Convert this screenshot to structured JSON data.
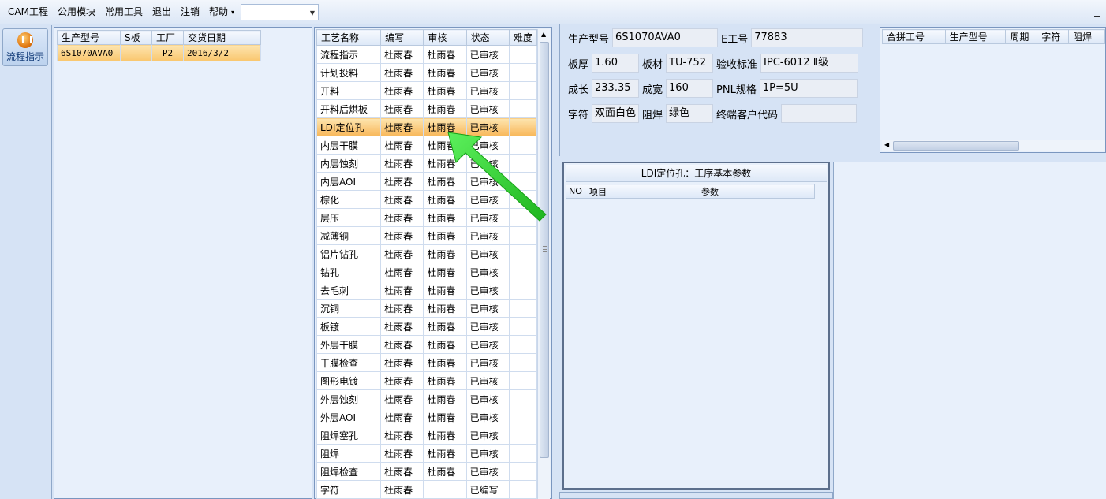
{
  "menu": {
    "items": [
      "CAM工程",
      "公用模块",
      "常用工具",
      "退出",
      "注销",
      "帮助"
    ],
    "help_arrow": "▾",
    "combo_value": "",
    "minimize": "_"
  },
  "nav": {
    "button_label": "流程指示",
    "icon": "pause-circle-icon"
  },
  "orders": {
    "headers": [
      "生产型号",
      "S板",
      "工厂",
      "交货日期"
    ],
    "rows": [
      [
        "6S1070AVA0",
        "",
        "P2",
        "2016/3/2"
      ]
    ]
  },
  "processes": {
    "headers": [
      "工艺名称",
      "编写",
      "审核",
      "状态",
      "难度"
    ],
    "selected_index": 4,
    "rows": [
      [
        "流程指示",
        "杜雨春",
        "杜雨春",
        "已审核",
        ""
      ],
      [
        "计划投料",
        "杜雨春",
        "杜雨春",
        "已审核",
        ""
      ],
      [
        "开料",
        "杜雨春",
        "杜雨春",
        "已审核",
        ""
      ],
      [
        "开料后烘板",
        "杜雨春",
        "杜雨春",
        "已审核",
        ""
      ],
      [
        "LDI定位孔",
        "杜雨春",
        "杜雨春",
        "已审核",
        ""
      ],
      [
        "内层干膜",
        "杜雨春",
        "杜雨春",
        "已审核",
        ""
      ],
      [
        "内层蚀刻",
        "杜雨春",
        "杜雨春",
        "已审核",
        ""
      ],
      [
        "内层AOI",
        "杜雨春",
        "杜雨春",
        "已审核",
        ""
      ],
      [
        "棕化",
        "杜雨春",
        "杜雨春",
        "已审核",
        ""
      ],
      [
        "层压",
        "杜雨春",
        "杜雨春",
        "已审核",
        ""
      ],
      [
        "减薄铜",
        "杜雨春",
        "杜雨春",
        "已审核",
        ""
      ],
      [
        "铝片钻孔",
        "杜雨春",
        "杜雨春",
        "已审核",
        ""
      ],
      [
        "钻孔",
        "杜雨春",
        "杜雨春",
        "已审核",
        ""
      ],
      [
        "去毛刺",
        "杜雨春",
        "杜雨春",
        "已审核",
        ""
      ],
      [
        "沉铜",
        "杜雨春",
        "杜雨春",
        "已审核",
        ""
      ],
      [
        "板镀",
        "杜雨春",
        "杜雨春",
        "已审核",
        ""
      ],
      [
        "外层干膜",
        "杜雨春",
        "杜雨春",
        "已审核",
        ""
      ],
      [
        "干膜检查",
        "杜雨春",
        "杜雨春",
        "已审核",
        ""
      ],
      [
        "图形电镀",
        "杜雨春",
        "杜雨春",
        "已审核",
        ""
      ],
      [
        "外层蚀刻",
        "杜雨春",
        "杜雨春",
        "已审核",
        ""
      ],
      [
        "外层AOI",
        "杜雨春",
        "杜雨春",
        "已审核",
        ""
      ],
      [
        "阻焊塞孔",
        "杜雨春",
        "杜雨春",
        "已审核",
        ""
      ],
      [
        "阻焊",
        "杜雨春",
        "杜雨春",
        "已审核",
        ""
      ],
      [
        "阻焊检查",
        "杜雨春",
        "杜雨春",
        "已审核",
        ""
      ],
      [
        "字符",
        "杜雨春",
        "",
        "已编写",
        ""
      ]
    ]
  },
  "info": {
    "model_label": "生产型号",
    "model_value": "6S1070AVA0",
    "eno_label": "E工号",
    "eno_value": "77883",
    "thickness_label": "板厚",
    "thickness_value": "1.60",
    "material_label": "板材",
    "material_value": "TU-752",
    "standard_label": "验收标准",
    "standard_value": "IPC-6012 Ⅱ级",
    "length_label": "成长",
    "length_value": "233.35",
    "width_label": "成宽",
    "width_value": "160",
    "pnl_label": "PNL规格",
    "pnl_value": "1P=5U",
    "char_label": "字符",
    "char_value": "双面白色",
    "mask_label": "阻焊",
    "mask_value": "绿色",
    "customer_label": "终端客户代码",
    "customer_value": ""
  },
  "combined": {
    "headers": [
      "合拼工号",
      "生产型号",
      "周期",
      "字符",
      "阻焊"
    ]
  },
  "params": {
    "title": "LDI定位孔：工序基本参数",
    "headers": [
      "NO",
      "项目",
      "参数"
    ]
  },
  "annotation": {
    "arrow_color": "#2bd12b"
  }
}
